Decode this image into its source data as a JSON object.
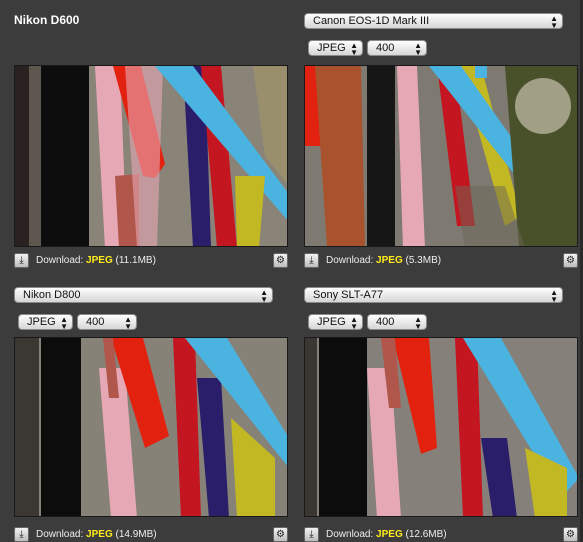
{
  "panels": [
    {
      "camera": "Nikon D600",
      "is_selector": false,
      "format": "",
      "iso": "",
      "download_label": "Download:",
      "download_format": "JPEG",
      "download_size": "(11.1MB)"
    },
    {
      "camera": "Canon EOS-1D Mark III",
      "is_selector": true,
      "format": "JPEG",
      "iso": "400",
      "download_label": "Download:",
      "download_format": "JPEG",
      "download_size": "(5.3MB)"
    },
    {
      "camera": "Nikon D800",
      "is_selector": true,
      "format": "JPEG",
      "iso": "400",
      "download_label": "Download:",
      "download_format": "JPEG",
      "download_size": "(14.9MB)"
    },
    {
      "camera": "Sony SLT-A77",
      "is_selector": true,
      "format": "JPEG",
      "iso": "400",
      "download_label": "Download:",
      "download_format": "JPEG",
      "download_size": "(12.6MB)"
    }
  ],
  "icons": {
    "download": "download-icon",
    "gear": "gear-icon",
    "select_arrows": "select-arrows-icon"
  },
  "colors": {
    "background": "#3c3c3c",
    "format_highlight": "#ffeb1a"
  }
}
